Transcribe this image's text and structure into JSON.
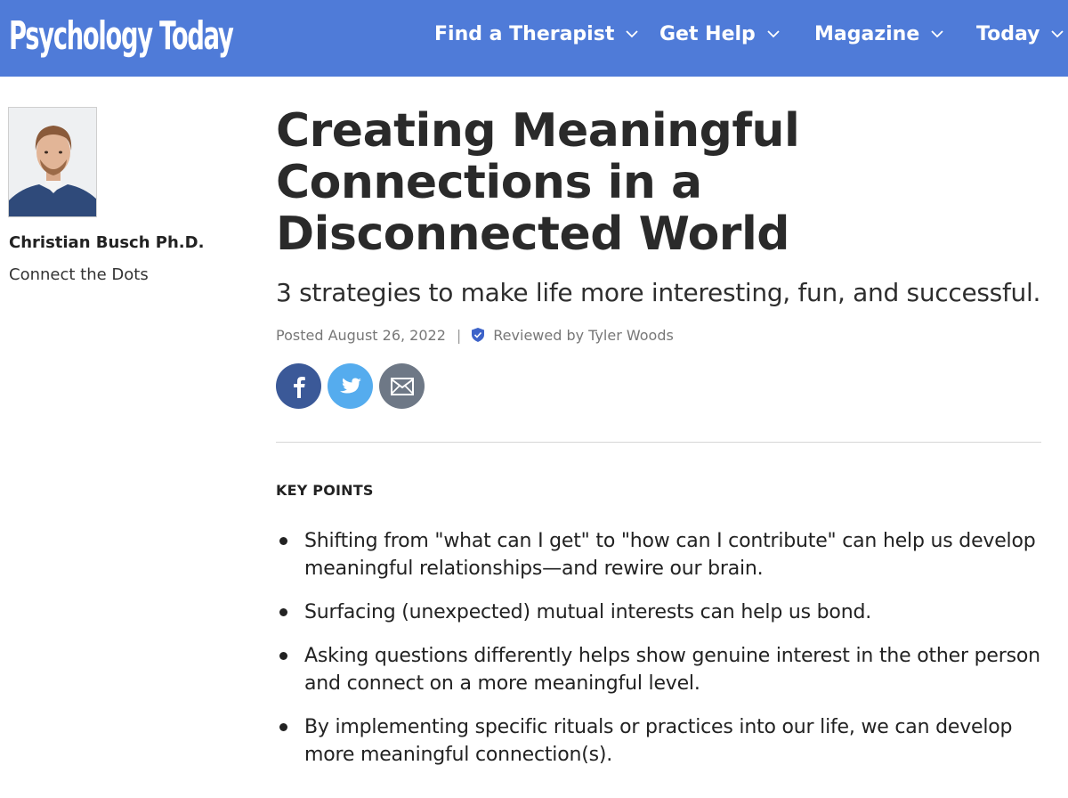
{
  "site": {
    "logo_text": "Psychology Today",
    "nav": [
      {
        "label": "Find a Therapist"
      },
      {
        "label": "Get Help"
      },
      {
        "label": "Magazine"
      },
      {
        "label": "Today"
      }
    ]
  },
  "author": {
    "name": "Christian Busch Ph.D.",
    "blog": "Connect the Dots"
  },
  "article": {
    "title": "Creating Meaningful Connections in a Disconnected World",
    "subtitle": "3 strategies to make life more interesting, fun, and successful.",
    "posted": "Posted August 26, 2022",
    "separator": "|",
    "reviewed": "Reviewed by Tyler Woods"
  },
  "share": {
    "facebook_icon": "facebook-icon",
    "twitter_icon": "twitter-icon",
    "email_icon": "email-icon"
  },
  "key_points": {
    "heading": "KEY POINTS",
    "items": [
      "Shifting from \"what can I get\" to \"how can I contribute\" can help us develop meaningful relationships—and rewire our brain.",
      "Surfacing (unexpected) mutual interests can help us bond.",
      "Asking questions differently helps show genuine interest in the other person and connect on a more meaningful level.",
      "By implementing specific rituals or practices into our life, we can develop more meaningful connection(s)."
    ]
  },
  "colors": {
    "nav_bg": "#4f7bd8",
    "facebook": "#3b5998",
    "twitter": "#55acee",
    "email": "#6e7886"
  }
}
